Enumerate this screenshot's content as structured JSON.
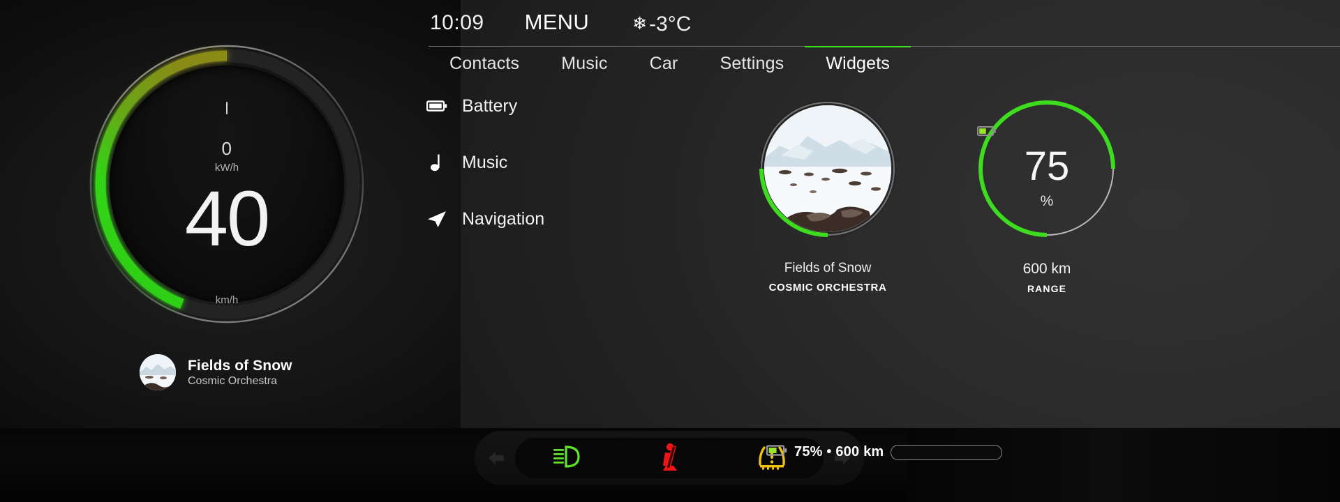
{
  "header": {
    "time": "10:09",
    "menu_label": "MENU",
    "snow_icon": "❄",
    "temperature": "-3°C"
  },
  "tabs": [
    {
      "label": "Contacts",
      "active": false
    },
    {
      "label": "Music",
      "active": false
    },
    {
      "label": "Car",
      "active": false
    },
    {
      "label": "Settings",
      "active": false
    },
    {
      "label": "Widgets",
      "active": true
    }
  ],
  "cluster": {
    "power_value": "0",
    "power_unit": "kW/h",
    "speed_value": "40",
    "speed_unit": "km/h",
    "arc_percent": 62,
    "arc_color_start": "#2ecc12",
    "arc_color_end": "#8a8a14"
  },
  "widget_list": [
    {
      "label": "Battery",
      "icon": "battery-icon"
    },
    {
      "label": "Music",
      "icon": "music-note-icon"
    },
    {
      "label": "Navigation",
      "icon": "navigation-arrow-icon"
    }
  ],
  "album_widget": {
    "title": "Fields of Snow",
    "artist": "COSMIC ORCHESTRA",
    "progress_percent": 22,
    "progress_color": "#3ddc1e",
    "artwork": "snowy-mountain-landscape"
  },
  "range_widget": {
    "value": "75",
    "unit": "%",
    "range": "600 km",
    "label": "RANGE",
    "battery_icon": "battery-half-icon",
    "arc_percent": 75,
    "arc_color": "#3ddc1e",
    "track_color": "#b9b9b9"
  },
  "now_playing": {
    "title": "Fields of Snow",
    "artist": "Cosmic Orchestra",
    "artwork": "snowy-mountain-landscape"
  },
  "warning_pod": {
    "left_arrow": "chevron-left-icon",
    "right_arrow": "chevron-right-icon",
    "indicators": [
      {
        "name": "headlight-low-beam-icon",
        "color": "#5ee52a"
      },
      {
        "name": "seatbelt-warning-icon",
        "color": "#f21414"
      },
      {
        "name": "tire-pressure-warning-icon",
        "color": "#f2c10b"
      }
    ]
  },
  "battery_strip": {
    "icon": "battery-half-icon",
    "text": "75% • 600 km",
    "percent": 75,
    "fill_color": "#3ddc1e"
  }
}
